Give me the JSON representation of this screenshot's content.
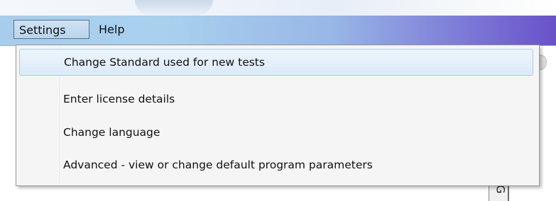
{
  "menubar": {
    "items": [
      {
        "label": "Settings"
      },
      {
        "label": "Help"
      }
    ]
  },
  "settings_menu": {
    "items": [
      {
        "label": "Change Standard used for new tests"
      },
      {
        "label": "Enter license details"
      },
      {
        "label": "Change language"
      },
      {
        "label": "Advanced - view or change default program parameters"
      }
    ]
  },
  "background": {
    "partial_glyph": "G"
  },
  "colors": {
    "menubar_start": "#a8ccec",
    "menubar_end": "#6a52c9",
    "highlight": "#dbeaf8",
    "dropdown_bg": "#f5f5f5"
  }
}
